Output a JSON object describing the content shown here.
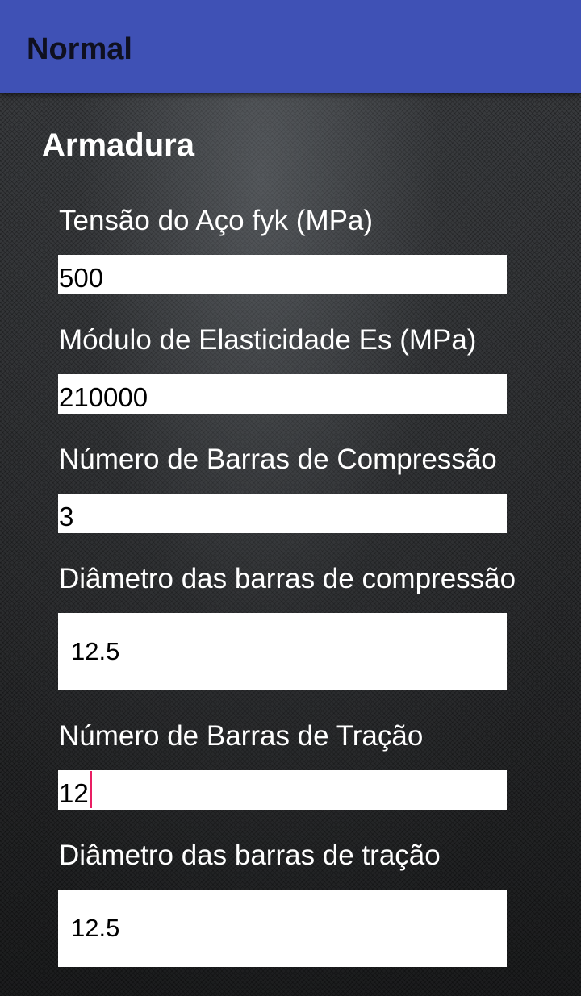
{
  "app_bar": {
    "title": "Normal"
  },
  "section": {
    "title": "Armadura"
  },
  "fields": [
    {
      "label": "Tensão do Aço fyk (MPa)",
      "value": "500"
    },
    {
      "label": "Módulo de Elasticidade Es (MPa)",
      "value": "210000"
    },
    {
      "label": "Número de Barras de Compressão",
      "value": "3"
    },
    {
      "label": "Diâmetro das barras de compressão",
      "value": "12.5"
    },
    {
      "label": "Número de Barras de Tração",
      "value": "12"
    },
    {
      "label": "Diâmetro das barras de tração",
      "value": "12.5"
    }
  ],
  "colors": {
    "app_bar": "#3f51b5",
    "cursor": "#e91e63",
    "input_background": "#ffffff"
  }
}
